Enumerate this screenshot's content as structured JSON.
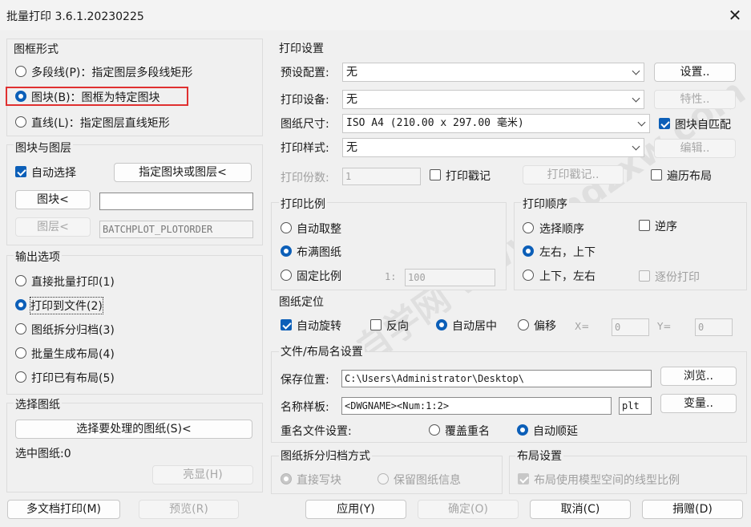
{
  "window": {
    "title": "批量打印 3.6.1.20230225",
    "close_icon": "close-icon"
  },
  "frame_form": {
    "title": "图框形式",
    "options": [
      {
        "label": "多段线(P)：指定图层多段线矩形",
        "selected": false
      },
      {
        "label": "图块(B)：图框为特定图块",
        "selected": true
      },
      {
        "label": "直线(L)：指定图层直线矩形",
        "selected": false
      }
    ]
  },
  "block_layer": {
    "title": "图块与图层",
    "auto_select": "自动选择",
    "specify_button": "指定图块或图层<",
    "block_button": "图块<",
    "block_value": "",
    "layer_button": "图层<",
    "layer_value": "BATCHPLOT_PLOTORDER"
  },
  "output": {
    "title": "输出选项",
    "options": [
      {
        "label": "直接批量打印(1)",
        "selected": false
      },
      {
        "label": "打印到文件(2)",
        "selected": true
      },
      {
        "label": "图纸拆分归档(3)",
        "selected": false
      },
      {
        "label": "批量生成布局(4)",
        "selected": false
      },
      {
        "label": "打印已有布局(5)",
        "selected": false
      }
    ]
  },
  "select_drawing": {
    "title": "选择图纸",
    "select_button": "选择要处理的图纸(S)<",
    "selected_label": "选中图纸:0",
    "highlight_button": "亮显(H)"
  },
  "print_settings": {
    "title": "打印设置",
    "preset_label": "预设配置:",
    "preset_value": "无",
    "setup_button": "设置..",
    "device_label": "打印设备:",
    "device_value": "无",
    "props_button": "特性..",
    "size_label": "图纸尺寸:",
    "size_value": "ISO A4 (210.00 x 297.00 毫米)",
    "auto_match": "图块自匹配",
    "style_label": "打印样式:",
    "style_value": "无",
    "edit_button": "编辑..",
    "copies_label": "打印份数:",
    "copies_value": "1",
    "stamp_check": "打印戳记",
    "stamp_button": "打印戳记..",
    "traverse_layout": "遍历布局"
  },
  "scale": {
    "title": "打印比例",
    "options": [
      {
        "label": "自动取整",
        "selected": false
      },
      {
        "label": "布满图纸",
        "selected": true
      },
      {
        "label": "固定比例",
        "selected": false
      }
    ],
    "ratio_prefix": "1:",
    "ratio_value": "100"
  },
  "order": {
    "title": "打印顺序",
    "options": [
      {
        "label": "选择顺序",
        "selected": false
      },
      {
        "label": "左右，上下",
        "selected": true
      },
      {
        "label": "上下，左右",
        "selected": false
      }
    ],
    "reverse": "逆序",
    "copy_print": "逐份打印"
  },
  "placement": {
    "title": "图纸定位",
    "auto_rotate": "自动旋转",
    "reverse": "反向",
    "center": "自动居中",
    "offset": "偏移",
    "x_label": "X=",
    "x_value": "0",
    "y_label": "Y=",
    "y_value": "0"
  },
  "file_naming": {
    "title": "文件/布局名设置",
    "save_label": "保存位置:",
    "save_value": "C:\\Users\\Administrator\\Desktop\\",
    "browse_button": "浏览..",
    "template_label": "名称样板:",
    "template_value": "<DWGNAME><Num:1:2>",
    "ext_value": "plt",
    "variable_button": "变量..",
    "dup_label": "重名文件设置:",
    "overwrite": "覆盖重名",
    "auto_increment": "自动顺延"
  },
  "split_archive": {
    "title": "图纸拆分归档方式",
    "direct": "直接写块",
    "keep_info": "保留图纸信息"
  },
  "layout_settings": {
    "title": "布局设置",
    "use_model_scale": "布局使用模型空间的线型比例"
  },
  "bottom": {
    "multi_doc": "多文档打印(M)",
    "preview": "预览(R)",
    "apply": "应用(Y)",
    "ok": "确定(O)",
    "cancel": "取消(C)",
    "donate": "捐赠(D)"
  },
  "watermark": "CAD自学网  www.cadzxw.com"
}
